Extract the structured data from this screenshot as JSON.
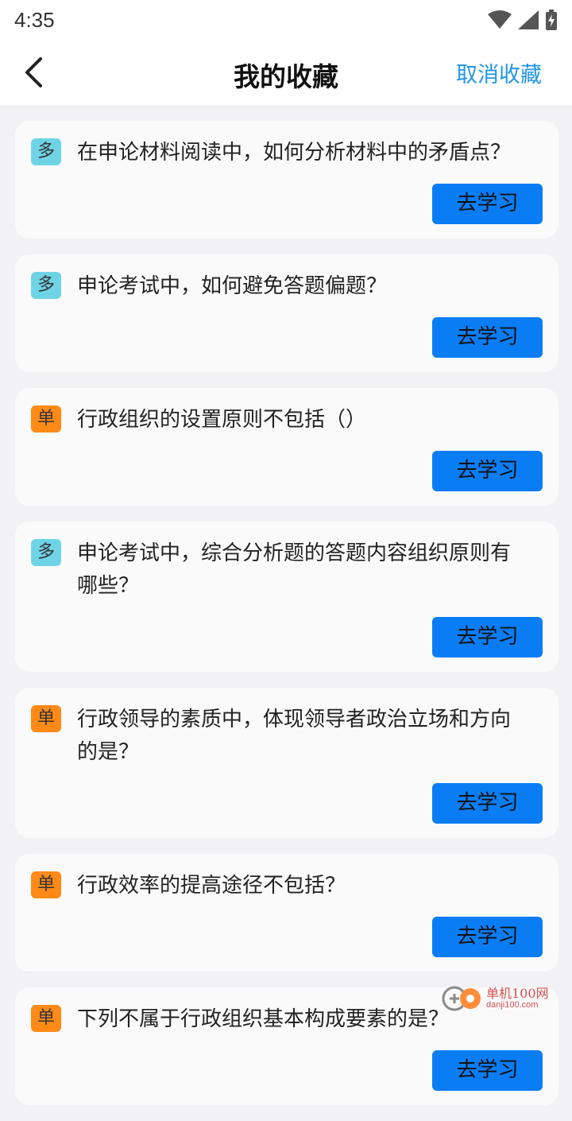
{
  "status_bar": {
    "time": "4:35"
  },
  "nav": {
    "title": "我的收藏",
    "action": "取消收藏"
  },
  "items": [
    {
      "badge": "多",
      "type": "multi",
      "question": "在申论材料阅读中，如何分析材料中的矛盾点？",
      "button": "去学习"
    },
    {
      "badge": "多",
      "type": "multi",
      "question": "申论考试中，如何避免答题偏题？",
      "button": "去学习"
    },
    {
      "badge": "单",
      "type": "single",
      "question": "行政组织的设置原则不包括（）",
      "button": "去学习"
    },
    {
      "badge": "多",
      "type": "multi",
      "question": "申论考试中，综合分析题的答题内容组织原则有哪些？",
      "button": "去学习"
    },
    {
      "badge": "单",
      "type": "single",
      "question": "行政领导的素质中，体现领导者政治立场和方向的是？",
      "button": "去学习"
    },
    {
      "badge": "单",
      "type": "single",
      "question": "行政效率的提高途径不包括？",
      "button": "去学习"
    },
    {
      "badge": "单",
      "type": "single",
      "question": "下列不属于行政组织基本构成要素的是？",
      "button": "去学习"
    }
  ],
  "watermark": {
    "text": "单机100网",
    "sub": "danji100.com"
  },
  "colors": {
    "accent": "#0a7df5",
    "multi_badge": "#6fd3e6",
    "single_badge": "#ff8a17",
    "action": "#2196e8"
  }
}
